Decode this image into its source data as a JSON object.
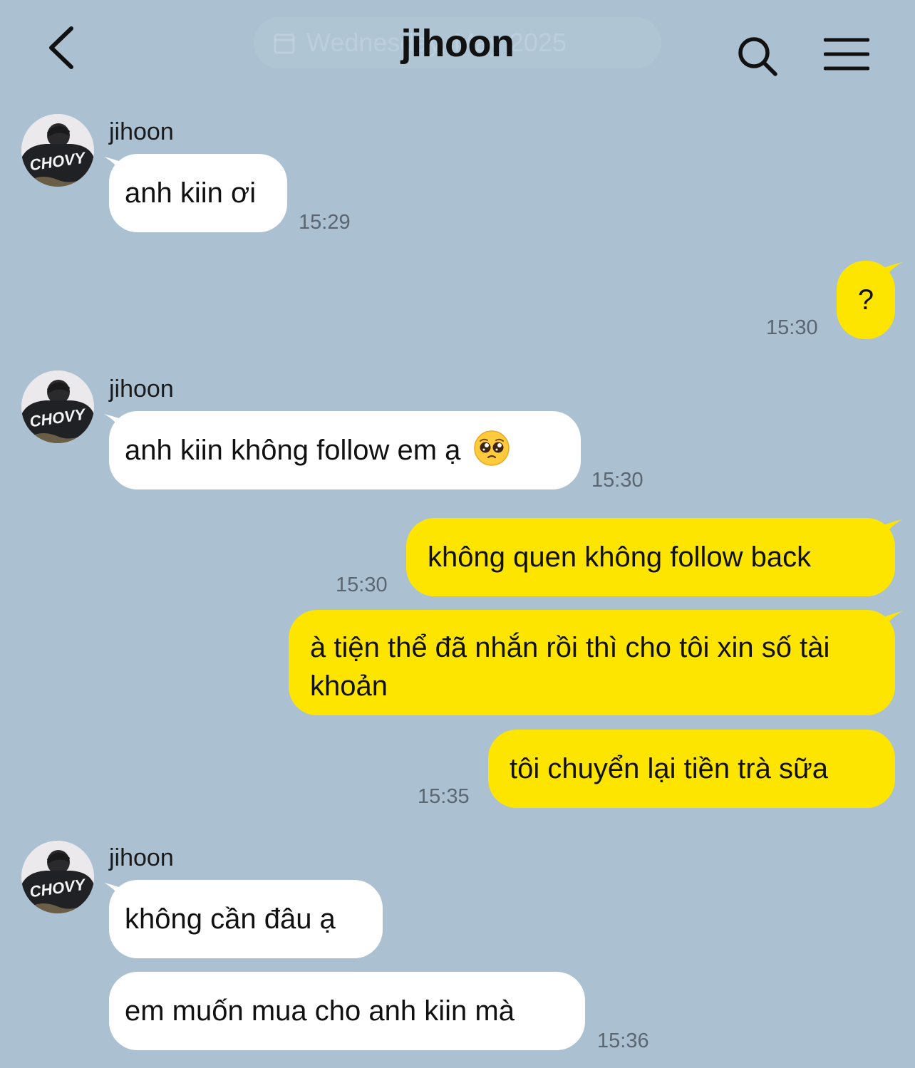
{
  "header": {
    "title": "jihoon",
    "date_chip": "Wednesday, May 2025"
  },
  "colors": {
    "background": "#abc1d1",
    "incoming_bubble": "#ffffff",
    "outgoing_bubble": "#fee500"
  },
  "icons": {
    "back": "chevron-left-icon",
    "search": "search-icon",
    "menu": "hamburger-menu-icon",
    "calendar": "calendar-icon",
    "emoji": "pleading-face-emoji"
  },
  "avatar_text": "CHOVY",
  "messages": [
    {
      "direction": "incoming",
      "sender": "jihoon",
      "text": "anh kiin ơi",
      "time": "15:29"
    },
    {
      "direction": "outgoing",
      "text": "?",
      "time": "15:30"
    },
    {
      "direction": "incoming",
      "sender": "jihoon",
      "text": "anh kiin không follow em ạ",
      "emoji": "🥺",
      "time": "15:30"
    },
    {
      "direction": "outgoing",
      "text": "không quen không follow back",
      "time": "15:30"
    },
    {
      "direction": "outgoing",
      "text": "à tiện thể đã nhắn rồi thì cho tôi xin số tài khoản"
    },
    {
      "direction": "outgoing",
      "text": "tôi chuyển lại tiền trà sữa",
      "time": "15:35"
    },
    {
      "direction": "incoming",
      "sender": "jihoon",
      "text": "không cần đâu ạ"
    },
    {
      "direction": "incoming",
      "text": "em muốn mua cho anh kiin mà",
      "time": "15:36"
    }
  ]
}
